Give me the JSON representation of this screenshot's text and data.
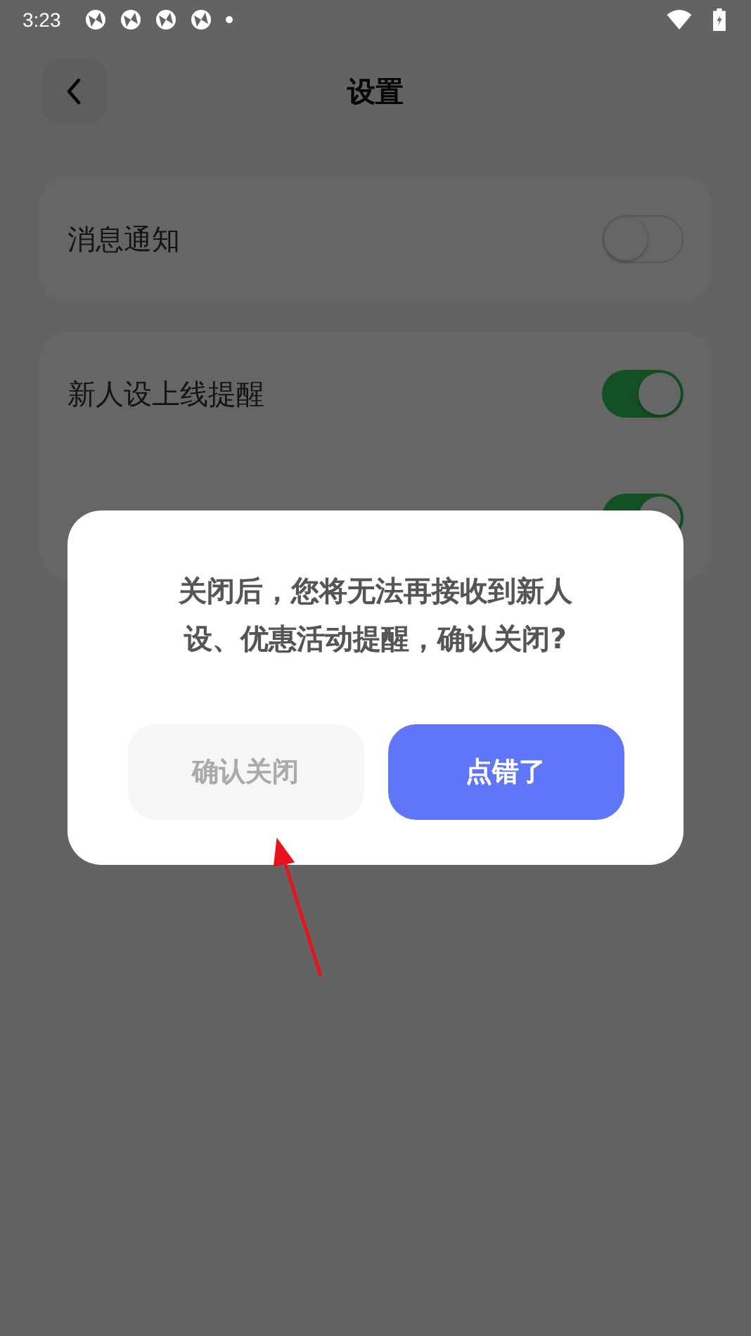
{
  "status_bar": {
    "time": "3:23"
  },
  "header": {
    "title": "设置"
  },
  "groups": [
    {
      "items": [
        {
          "label": "消息通知",
          "on": false
        }
      ]
    },
    {
      "items": [
        {
          "label": "新人设上线提醒",
          "on": true
        },
        {
          "on": true
        }
      ]
    }
  ],
  "dialog": {
    "message": "关闭后，您将无法再接收到新人设、优惠活动提醒，确认关闭?",
    "buttons": [
      {
        "label": "确认关闭",
        "kind": "secondary"
      },
      {
        "label": "点错了",
        "kind": "primary"
      }
    ]
  }
}
